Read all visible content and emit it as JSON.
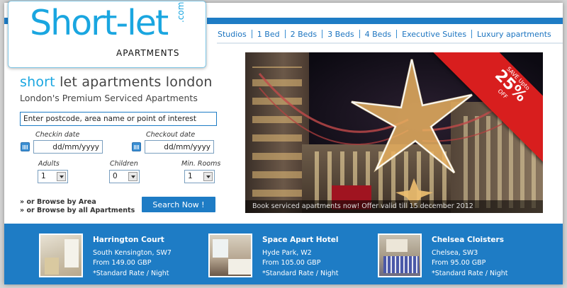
{
  "logo": {
    "main": "Short-let",
    "dotcom": ".com",
    "sub": "APARTMENTS"
  },
  "nav": {
    "items": [
      "Studios",
      "1 Bed",
      "2 Beds",
      "3 Beds",
      "4 Beds",
      "Executive Suites",
      "Luxury apartments"
    ]
  },
  "search": {
    "headline_highlight": "short",
    "headline_rest": " let apartments london",
    "subhead": "London's Premium Serviced Apartments",
    "location_value": "Enter postcode, area name or point of interest",
    "checkin_label": "Checkin date",
    "checkin_value": "dd/mm/yyyy",
    "checkout_label": "Checkout date",
    "checkout_value": "dd/mm/yyyy",
    "adults_label": "Adults",
    "adults_value": "1",
    "children_label": "Children",
    "children_value": "0",
    "rooms_label": "Min. Rooms",
    "rooms_value": "1",
    "browse_area": "» or Browse by Area",
    "browse_all": "» or Browse by all Apartments",
    "button": "Search Now !"
  },
  "hero": {
    "caption": "Book serviced apartments now! Offer valid till 15 december 2012",
    "promo_line1": "SAVE Upto",
    "promo_line2": "25%",
    "promo_line3": "OFF"
  },
  "properties": [
    {
      "name": "Harrington Court",
      "location": "South Kensington, SW7",
      "price": "From 149.00 GBP",
      "note": "*Standard Rate / Night"
    },
    {
      "name": "Space Apart Hotel",
      "location": "Hyde Park, W2",
      "price": "From 105.00 GBP",
      "note": "*Standard Rate / Night"
    },
    {
      "name": "Chelsea Cloisters",
      "location": "Chelsea, SW3",
      "price": "From 95.00 GBP",
      "note": "*Standard Rate / Night"
    }
  ],
  "colors": {
    "brand_blue": "#1e7cc5",
    "logo_cyan": "#1aa6e0",
    "promo_red": "#d81e1e"
  }
}
